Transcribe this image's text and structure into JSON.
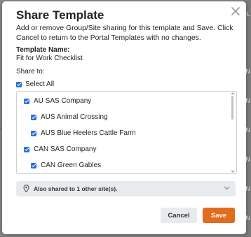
{
  "modal": {
    "title": "Share Template",
    "description": "Add or remove Group/Site sharing for this template and Save. Click Cancel to return to the Portal Templates with no changes.",
    "template_name_label": "Template Name:",
    "template_name_value": "Fit for Work Checklist",
    "share_to_label": "Share to:",
    "select_all_label": "Select All",
    "sites": [
      {
        "label": "AU SAS Company",
        "checked": true,
        "level": 0
      },
      {
        "label": "AUS Animal Crossing",
        "checked": true,
        "level": 1
      },
      {
        "label": "AUS Blue Heelers Cattle Farm",
        "checked": true,
        "level": 1
      },
      {
        "label": "CAN SAS Company",
        "checked": true,
        "level": 0
      },
      {
        "label": "CAN Green Gables",
        "checked": true,
        "level": 1
      }
    ],
    "also_shared_text": "Also shared to 1 other site(s).",
    "cancel_label": "Cancel",
    "save_label": "Save"
  },
  "colors": {
    "accent": "#2a6fd6",
    "save": "#e36b1e",
    "panel_bg": "#e8ebee"
  },
  "icons": [
    "close-icon",
    "checkbox-checked-icon",
    "location-pin-icon",
    "chevron-down-icon"
  ]
}
